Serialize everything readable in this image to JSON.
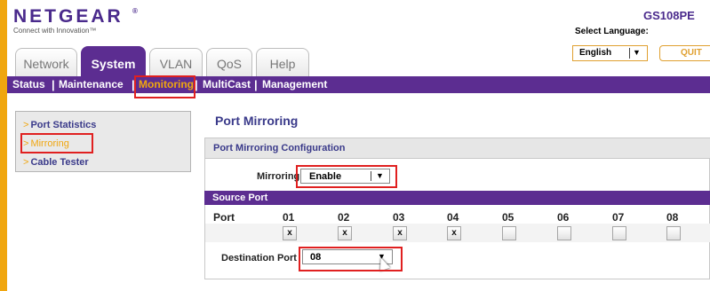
{
  "brand": {
    "name": "NETGEAR",
    "registered": "®",
    "tagline": "Connect with Innovation™"
  },
  "model": "GS108PE",
  "language": {
    "label": "Select Language:",
    "selected": "English"
  },
  "quit_label": "QUIT",
  "tabs": [
    {
      "label": "Network",
      "active": false
    },
    {
      "label": "System",
      "active": true
    },
    {
      "label": "VLAN",
      "active": false
    },
    {
      "label": "QoS",
      "active": false
    },
    {
      "label": "Help",
      "active": false
    }
  ],
  "subnav": [
    {
      "label": "Status",
      "active": false
    },
    {
      "label": "Maintenance",
      "active": false
    },
    {
      "label": "Monitoring",
      "active": true
    },
    {
      "label": "MultiCast",
      "active": false
    },
    {
      "label": "Management",
      "active": false
    }
  ],
  "sidebar": {
    "items": [
      {
        "label": "Port Statistics",
        "active": false
      },
      {
        "label": "Mirroring",
        "active": true
      },
      {
        "label": "Cable Tester",
        "active": false
      }
    ]
  },
  "main": {
    "title": "Port Mirroring",
    "section_title": "Port Mirroring Configuration",
    "mirroring_label": "Mirroring",
    "mirroring_value": "Enable",
    "source_port_title": "Source Port",
    "port_header_label": "Port",
    "ports": [
      {
        "number": "01",
        "checked": true,
        "mark": "x"
      },
      {
        "number": "02",
        "checked": true,
        "mark": "x"
      },
      {
        "number": "03",
        "checked": true,
        "mark": "x"
      },
      {
        "number": "04",
        "checked": true,
        "mark": "x"
      },
      {
        "number": "05",
        "checked": false,
        "mark": ""
      },
      {
        "number": "06",
        "checked": false,
        "mark": ""
      },
      {
        "number": "07",
        "checked": false,
        "mark": ""
      },
      {
        "number": "08",
        "checked": false,
        "mark": ""
      }
    ],
    "destination_label": "Destination Port",
    "destination_value": "08"
  },
  "colors": {
    "brand_purple": "#5c2d91",
    "accent_orange": "#f0a60f",
    "highlight_red": "#e02020"
  }
}
